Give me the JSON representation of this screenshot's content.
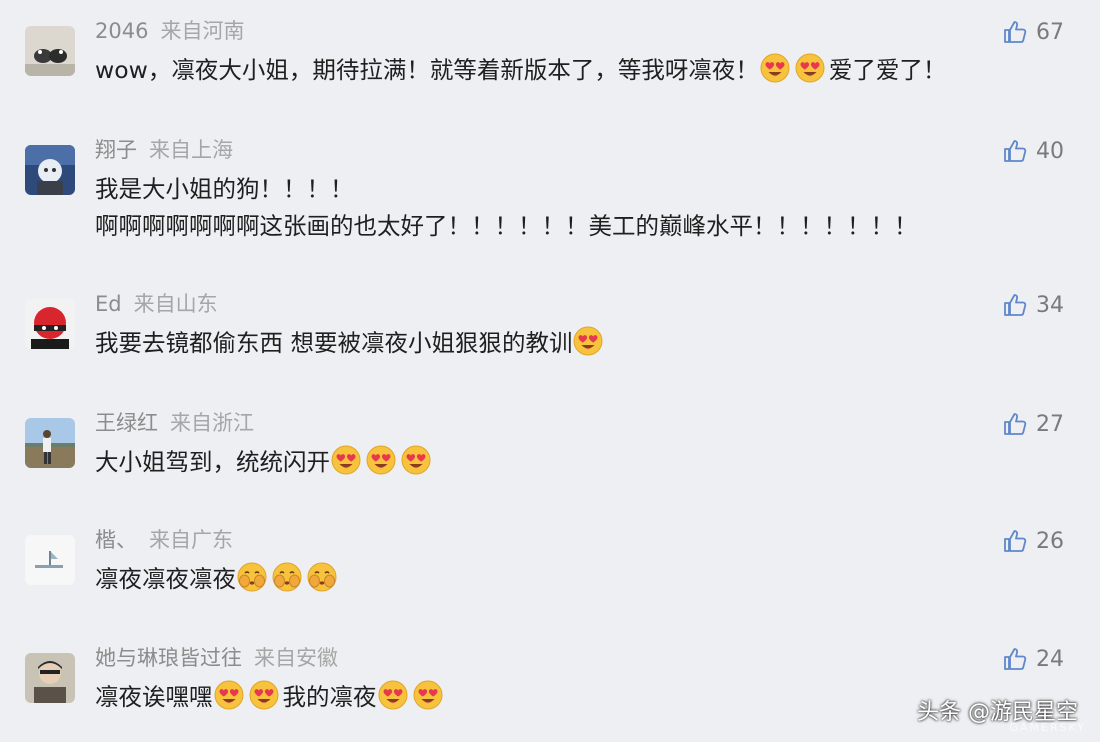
{
  "comments": [
    {
      "user": "2046",
      "location": "来自河南",
      "likes": "67",
      "lines": [
        [
          {
            "t": "text",
            "v": "wow，凛夜大小姐，期待拉满！就等着新版本了，等我呀凛夜！"
          },
          {
            "t": "emoji",
            "icon": "heart-eyes-emoji"
          },
          {
            "t": "emoji",
            "icon": "heart-eyes-emoji"
          },
          {
            "t": "text",
            "v": "爱了爱了！"
          }
        ]
      ]
    },
    {
      "user": "翔子",
      "location": "来自上海",
      "likes": "40",
      "lines": [
        [
          {
            "t": "text",
            "v": "我是大小姐的狗！！！！"
          }
        ],
        [
          {
            "t": "text",
            "v": "啊啊啊啊啊啊啊这张画的也太好了！！！！！！美工的巅峰水平！！！！！！！"
          }
        ]
      ]
    },
    {
      "user": "Ed",
      "location": "来自山东",
      "likes": "34",
      "lines": [
        [
          {
            "t": "text",
            "v": "我要去镜都偷东西  想要被凛夜小姐狠狠的教训"
          },
          {
            "t": "emoji",
            "icon": "heart-eyes-emoji"
          }
        ]
      ]
    },
    {
      "user": "王绿红",
      "location": "来自浙江",
      "likes": "27",
      "lines": [
        [
          {
            "t": "text",
            "v": "大小姐驾到，统统闪开"
          },
          {
            "t": "emoji",
            "icon": "heart-eyes-emoji"
          },
          {
            "t": "emoji",
            "icon": "heart-eyes-emoji"
          },
          {
            "t": "emoji",
            "icon": "heart-eyes-emoji"
          }
        ]
      ]
    },
    {
      "user": "楷、",
      "location": "来自广东",
      "likes": "26",
      "lines": [
        [
          {
            "t": "text",
            "v": "凛夜凛夜凛夜"
          },
          {
            "t": "emoji",
            "icon": "shy-hands-emoji"
          },
          {
            "t": "emoji",
            "icon": "shy-hands-emoji"
          },
          {
            "t": "emoji",
            "icon": "shy-hands-emoji"
          }
        ]
      ]
    },
    {
      "user": "她与琳琅皆过往",
      "location": "来自安徽",
      "likes": "24",
      "lines": [
        [
          {
            "t": "text",
            "v": "凛夜诶嘿嘿"
          },
          {
            "t": "emoji",
            "icon": "heart-eyes-emoji"
          },
          {
            "t": "emoji",
            "icon": "heart-eyes-emoji"
          },
          {
            "t": "text",
            "v": "我的凛夜"
          },
          {
            "t": "emoji",
            "icon": "heart-eyes-emoji"
          },
          {
            "t": "emoji",
            "icon": "heart-eyes-emoji"
          }
        ]
      ]
    }
  ],
  "watermark": "头条 @游民星空",
  "watermark_sub": "GAMERSKY",
  "colors": {
    "background": "#eeeff2",
    "username": "#8c8c8c",
    "text": "#1f1f1f",
    "like": "#5f87c9"
  },
  "icons": {
    "like": "thumbs-up-icon"
  }
}
